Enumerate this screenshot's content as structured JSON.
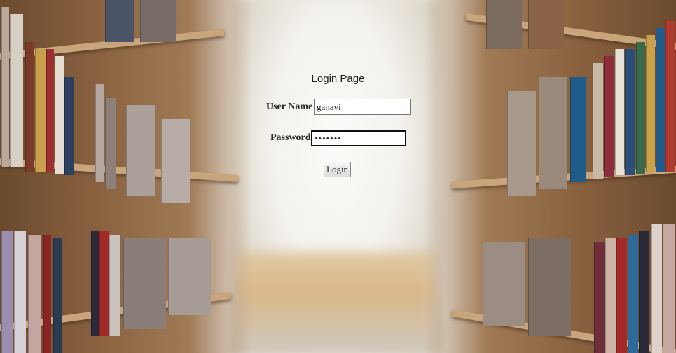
{
  "page": {
    "title": "Login Page"
  },
  "form": {
    "username_label": "User Name",
    "username_value": "ganavi",
    "password_label": "Password",
    "password_value": "•••••••",
    "login_label": "Login"
  },
  "background": {
    "scene": "library-bookshelves-icon"
  }
}
